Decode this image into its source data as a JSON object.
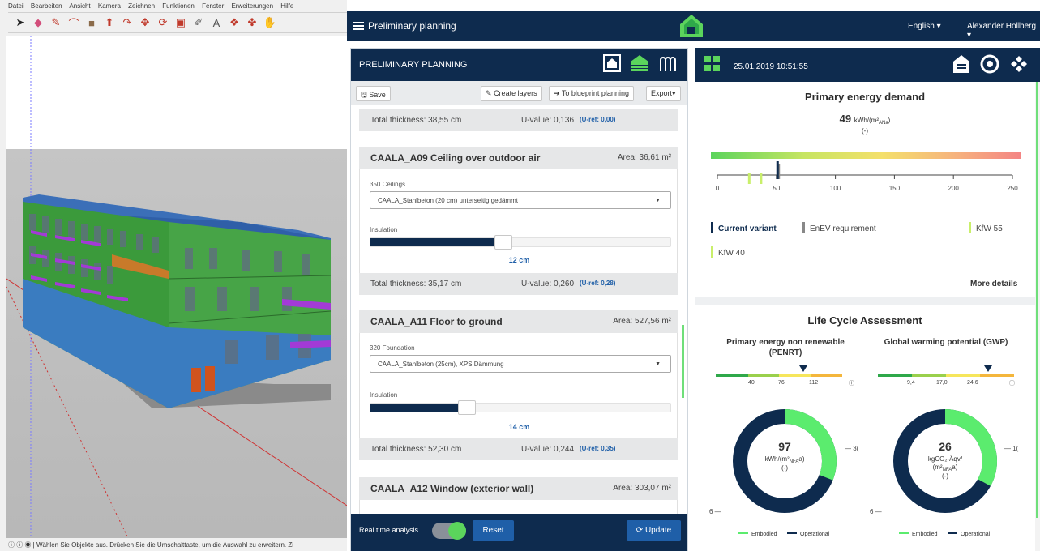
{
  "sketchup": {
    "menu": [
      "Datei",
      "Bearbeiten",
      "Ansicht",
      "Kamera",
      "Zeichnen",
      "Funktionen",
      "Fenster",
      "Erweiterungen",
      "Hilfe"
    ],
    "status_text": "Wählen Sie Objekte aus. Drücken Sie die Umschalttaste, um die Auswahl zu erweitern. Zi"
  },
  "app": {
    "title": "Preliminary planning",
    "language": "English",
    "user": "Alexander Hollberg",
    "brand_color": "#0e2b4e",
    "accent_color": "#5bd45c"
  },
  "planning": {
    "header": "PRELIMINARY PLANNING",
    "toolbar": {
      "save": "Save",
      "create_layers": "Create layers",
      "to_blueprint": "To blueprint planning",
      "export": "Export"
    },
    "top_summary": {
      "thickness": "Total thickness: 38,55 cm",
      "uvalue": "U-value: 0,136",
      "uref": "(U-ref: 0,00)"
    },
    "cards": [
      {
        "title": "CAALA_A09 Ceiling over outdoor air",
        "area": "Area: 36,61 m²",
        "category": "350 Ceilings",
        "material": "CAALA_Stahlbeton (20 cm) unterseitig gedämmt",
        "insulation_label": "Insulation",
        "insulation_value": "12 cm",
        "insulation_fraction": 0.44,
        "thickness": "Total thickness: 35,17 cm",
        "uvalue": "U-value: 0,260",
        "uref": "(U-ref: 0,28)"
      },
      {
        "title": "CAALA_A11 Floor to ground",
        "area": "Area: 527,56 m²",
        "category": "320 Foundation",
        "material": "CAALA_Stahlbeton (25cm), XPS Dämmung",
        "insulation_label": "Insulation",
        "insulation_value": "14 cm",
        "insulation_fraction": 0.32,
        "thickness": "Total thickness: 52,30 cm",
        "uvalue": "U-value: 0,244",
        "uref": "(U-ref: 0,35)"
      },
      {
        "title": "CAALA_A12 Window (exterior wall)",
        "area": "Area: 303,07 m²"
      }
    ],
    "footer": {
      "realtime_label": "Real time analysis",
      "reset": "Reset",
      "update": "Update"
    }
  },
  "results": {
    "date": "25.01.2019 10:51:55",
    "primary_energy": {
      "title": "Primary energy demand",
      "value": "49",
      "unit": "kWh/(m²",
      "unit_sub": "ANa",
      "unit_end": ")",
      "sub": "(-)",
      "axis_ticks": [
        "0",
        "50",
        "100",
        "150",
        "200",
        "250"
      ],
      "current_variant_value": 51,
      "enev_value": 52,
      "kfw55_value": 37,
      "kfw40_value": 27,
      "legend": {
        "current": "Current variant",
        "enev": "EnEV requirement",
        "kfw55": "KfW 55",
        "kfw40": "KfW 40"
      },
      "more": "More details"
    },
    "lca": {
      "title": "Life Cycle Assessment",
      "penrt": {
        "title": "Primary energy non renewable (PENRT)",
        "scale": [
          "40",
          "76",
          "112"
        ],
        "value": "97",
        "unit_line1": "kWh/(m²",
        "unit_sub": "NFA",
        "unit_line1_end": "a)",
        "sub": "(-)",
        "embodied_fraction": 0.31,
        "left_label": "6",
        "right_label": "3("
      },
      "gwp": {
        "title": "Global warming potential (GWP)",
        "scale": [
          "9,4",
          "17,0",
          "24,6"
        ],
        "value": "26",
        "unit_line1": "kgCO₂-Äqv/",
        "unit_line2": "(m²",
        "unit_sub": "NFA",
        "unit_line2_end": "a)",
        "sub": "(-)",
        "embodied_fraction": 0.33,
        "left_label": "6",
        "right_label": "1("
      },
      "legend": {
        "embodied": "Embodied",
        "operational": "Operational"
      }
    }
  }
}
